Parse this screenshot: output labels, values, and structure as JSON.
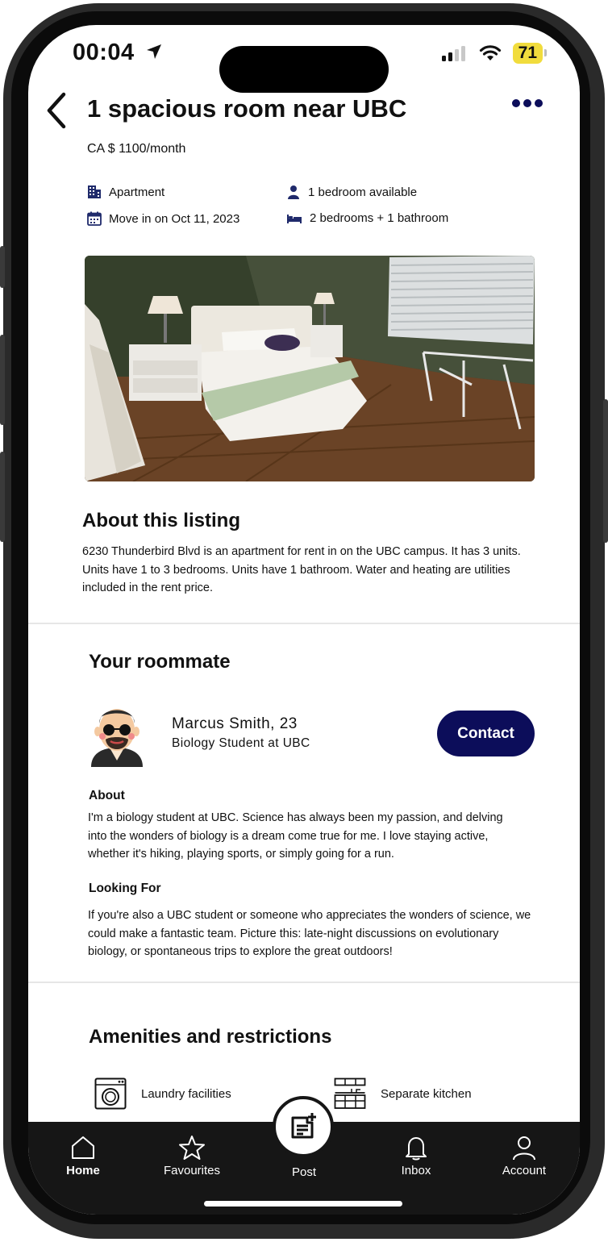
{
  "status_bar": {
    "time": "00:04",
    "battery": "71"
  },
  "header": {
    "title": "1 spacious room near UBC",
    "price": "CA $ 1100/month"
  },
  "facts": {
    "type": "Apartment",
    "move_in": "Move in on Oct 11, 2023",
    "bedrooms_available": "1 bedroom available",
    "layout": "2 bedrooms + 1 bathroom"
  },
  "about_listing": {
    "heading": "About this listing",
    "text": "6230 Thunderbird Blvd is an apartment for rent in on the UBC campus. It has 3 units. Units have 1 to 3 bedrooms. Units have 1 bathroom. Water and heating are utilities included in the rent price."
  },
  "roommate": {
    "heading": "Your roommate",
    "name": "Marcus Smith, 23",
    "subtitle": "Biology Student at UBC",
    "contact_label": "Contact",
    "about_heading": "About",
    "about_text": "I'm a biology student at UBC. Science has always been my passion, and delving into the wonders of biology is a dream come true for me. I love staying active, whether it's hiking, playing sports, or simply going for a run.",
    "looking_heading": "Looking For",
    "looking_text": "If you're also a UBC student or someone who appreciates the wonders of science, we could make a fantastic team. Picture this: late-night discussions on evolutionary biology, or spontaneous trips to explore the great outdoors!"
  },
  "amenities": {
    "heading": "Amenities and restrictions",
    "items": [
      "Laundry facilities",
      "Separate kitchen"
    ]
  },
  "tabbar": {
    "items": [
      "Home",
      "Favourites",
      "Post",
      "Inbox",
      "Account"
    ]
  },
  "colors": {
    "accent": "#0c0d5a",
    "tabbar_bg": "#161616",
    "battery": "#f1dc3d"
  }
}
